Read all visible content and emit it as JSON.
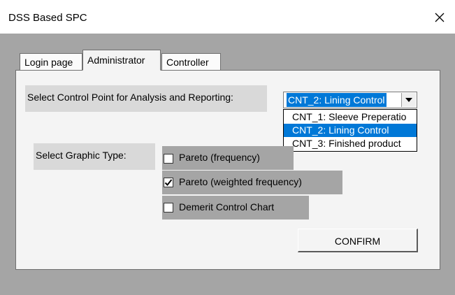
{
  "window": {
    "title": "DSS Based SPC",
    "close_icon": "close-icon"
  },
  "tabs": [
    {
      "label": "Login page",
      "active": false
    },
    {
      "label": "Administrator",
      "active": true
    },
    {
      "label": "Controller",
      "active": false
    }
  ],
  "control_point": {
    "label": "Select Control Point for Analysis and Reporting:",
    "selected": "CNT_2: Lining Control",
    "options": [
      "CNT_1: Sleeve Preperatio",
      "CNT_2: Lining Control",
      "CNT_3: Finished product"
    ],
    "selected_index": 1
  },
  "graphic_type": {
    "label": "Select Graphic Type:",
    "options": [
      {
        "label": "Pareto (frequency)",
        "checked": false
      },
      {
        "label": "Pareto (weighted frequency)",
        "checked": true
      },
      {
        "label": "Demerit Control Chart",
        "checked": false
      }
    ]
  },
  "confirm_label": "CONFIRM",
  "colors": {
    "selection": "#0078d7",
    "panel": "#f4f4f4",
    "background": "#a5a5a5"
  }
}
